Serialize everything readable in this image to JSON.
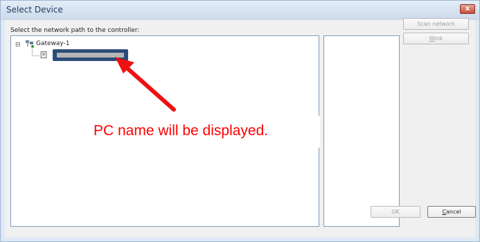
{
  "window": {
    "title": "Select Device",
    "close_label": "x"
  },
  "dialog": {
    "prompt": "Select the network path to the controller:",
    "tree": {
      "expander": "⊟",
      "gateway_label": "Gateway-1",
      "gateway_icon": "network-gateway-icon",
      "pc_icon": "pc-icon"
    },
    "buttons": {
      "scan_network": "Scan network",
      "wink_underlined": "W",
      "wink_rest": "ink",
      "ok": "OK",
      "cancel_underlined": "C",
      "cancel_rest": "ancel"
    }
  },
  "annotation": {
    "text": "PC name will be displayed.",
    "color": "#ff0000"
  },
  "colors": {
    "highlight_border": "#2f4f7a",
    "close_button": "#c74b3a"
  }
}
